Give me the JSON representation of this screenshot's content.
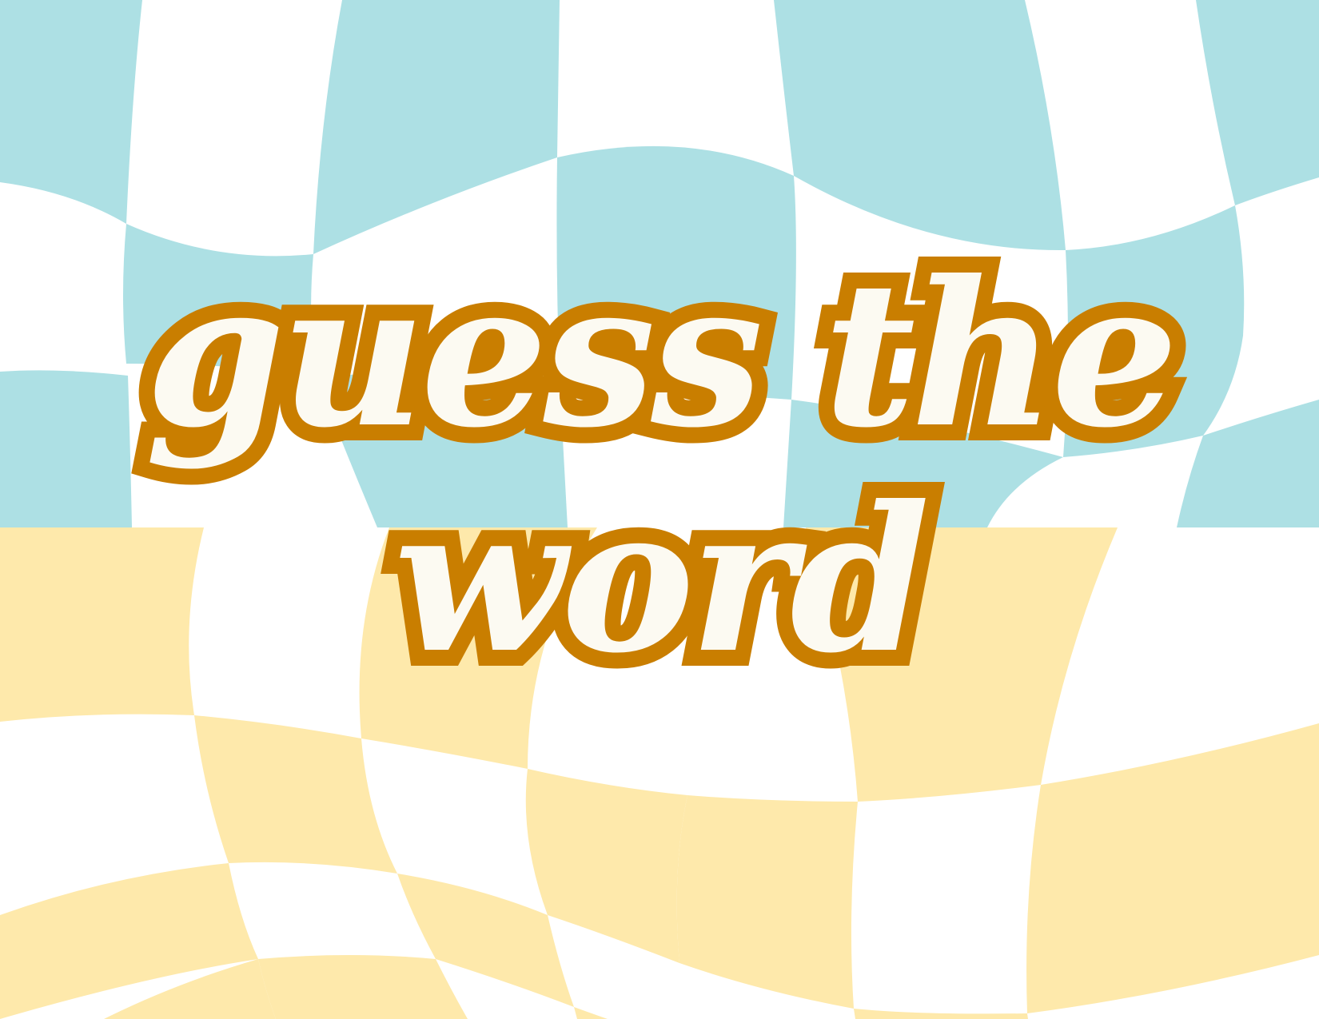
{
  "title": {
    "line1": "guess the",
    "line2": "word"
  },
  "colors": {
    "background": "#ffffff",
    "checker_blue": "#ade0e4",
    "checker_yellow": "#fee9ab",
    "title_fill": "#fcfaf2",
    "title_outline": "#c97e00"
  }
}
